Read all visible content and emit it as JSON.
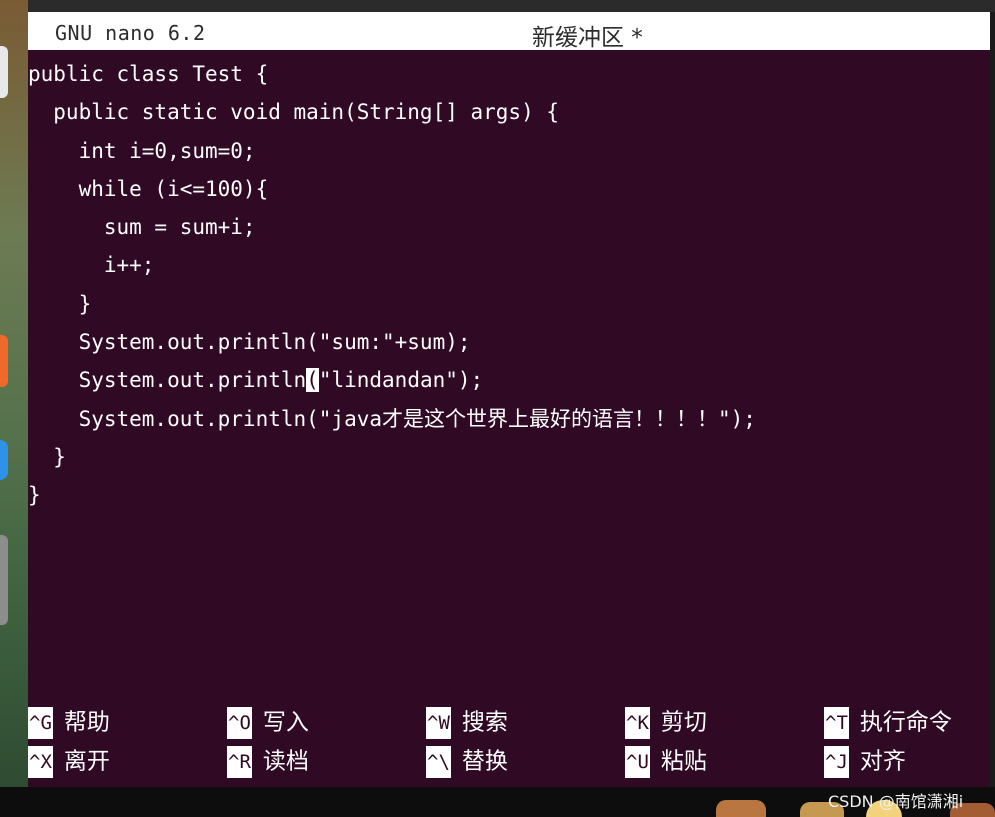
{
  "window": {
    "app_version": "GNU nano 6.2",
    "buffer_name": "新缓冲区 *"
  },
  "editor": {
    "lines": [
      "public class Test {",
      "  public static void main(String[] args) {",
      "    int i=0,sum=0;",
      "    while (i<=100){",
      "      sum = sum+i;",
      "      i++;",
      "    }",
      "    System.out.println(\"sum:\"+sum);",
      "    System.out.println(\"lindandan\");",
      "    System.out.println(\"java才是这个世界上最好的语言！！！！\");",
      "  }",
      "}"
    ],
    "cursor": {
      "line": 8,
      "column": 22
    }
  },
  "shortcuts": [
    {
      "key": "^G",
      "label": "帮助"
    },
    {
      "key": "^O",
      "label": "写入"
    },
    {
      "key": "^W",
      "label": "搜索"
    },
    {
      "key": "^K",
      "label": "剪切"
    },
    {
      "key": "^T",
      "label": "执行命令"
    },
    {
      "key": "^X",
      "label": "离开"
    },
    {
      "key": "^R",
      "label": "读档"
    },
    {
      "key": "^\\",
      "label": "替换"
    },
    {
      "key": "^U",
      "label": "粘贴"
    },
    {
      "key": "^J",
      "label": "对齐"
    }
  ],
  "watermark": "CSDN @南馆潇湘i",
  "colors": {
    "terminal_bg": "#300a24",
    "text": "#ffffff",
    "titlebar_bg": "#ffffff"
  }
}
